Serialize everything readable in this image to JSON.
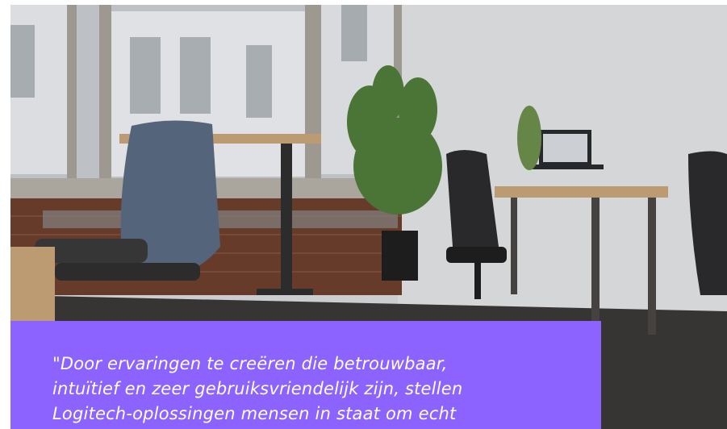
{
  "hero": {
    "image_alt": "Office workspace with ergonomic chairs, standing desks, laptop and large windows"
  },
  "quote": {
    "text": "\"Door ervaringen te creëren die betrouwbaar,\nintuïtief en zeer gebruiksvriendelijk zijn, stellen\nLogitech-oplossingen mensen in staat om echt"
  },
  "colors": {
    "quote_background": "#8d63ff",
    "quote_text": "#ffffff"
  }
}
